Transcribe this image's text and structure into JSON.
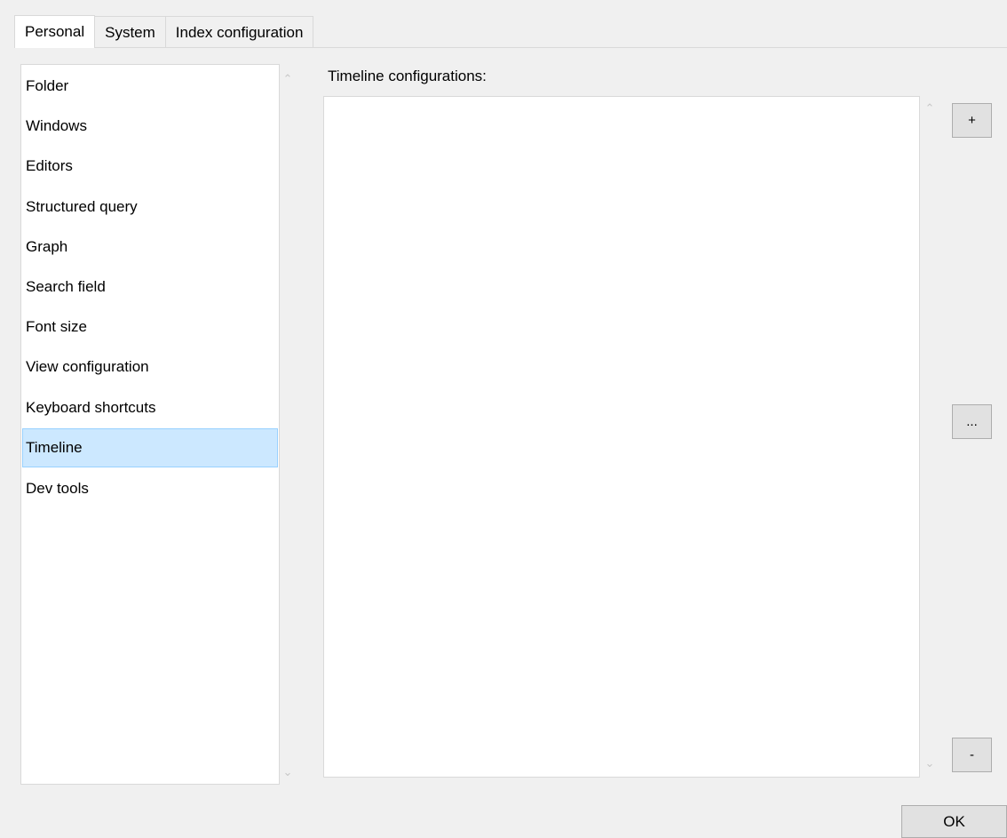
{
  "tabs": [
    {
      "label": "Personal",
      "active": true
    },
    {
      "label": "System",
      "active": false
    },
    {
      "label": "Index configuration",
      "active": false
    }
  ],
  "categories": [
    {
      "label": "Folder"
    },
    {
      "label": "Windows"
    },
    {
      "label": "Editors"
    },
    {
      "label": "Structured query"
    },
    {
      "label": "Graph"
    },
    {
      "label": "Search field"
    },
    {
      "label": "Font size"
    },
    {
      "label": "View configuration"
    },
    {
      "label": "Keyboard shortcuts"
    },
    {
      "label": "Timeline",
      "selected": true
    },
    {
      "label": "Dev tools"
    }
  ],
  "timeline": {
    "label": "Timeline configurations:",
    "items": [],
    "add_label": "+",
    "edit_label": "...",
    "remove_label": "-"
  },
  "footer": {
    "ok_label": "OK"
  },
  "colors": {
    "background": "#f0f0f0",
    "selected_fill": "#cce8ff",
    "selected_border": "#99d1ff",
    "button_fill": "#e1e1e1"
  },
  "icons": {
    "scroll_up": "chevron-up-icon",
    "scroll_down": "chevron-down-icon"
  }
}
